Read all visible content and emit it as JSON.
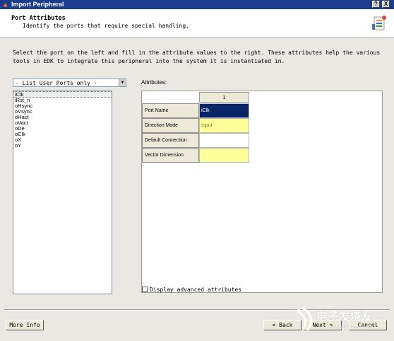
{
  "window": {
    "title": "Import Peripheral",
    "help_button": "?",
    "close_button": "X"
  },
  "header": {
    "title": "Port Attributes",
    "subtitle": "Identify the ports that require special handling."
  },
  "description": "Select the port on the left and fill in the attribute values to the right. These attributes help the various tools in EDK to integrate this peripheral into the system it is instantiated in.",
  "port_filter": {
    "selected": "- List User Ports only -"
  },
  "ports": [
    "iClk",
    "iRst_n",
    "oHsync",
    "oVsync",
    "oHact",
    "oVact",
    "oDe",
    "oClk",
    "oX",
    "oY"
  ],
  "attributes": {
    "label": "Attributes:",
    "column_header": "1",
    "rows": [
      {
        "name": "Port Name",
        "value": "iClk"
      },
      {
        "name": "Direction Mode",
        "value": "Input"
      },
      {
        "name": "Default Connection",
        "value": ""
      },
      {
        "name": "Vector Dimension",
        "value": ""
      }
    ]
  },
  "advanced": {
    "label": "Display advanced attributes",
    "checked": false
  },
  "footer": {
    "more_info": "More Info",
    "back": "< Back",
    "next": "Next >",
    "cancel": "Cancel"
  },
  "watermark": {
    "title": "电子发烧友",
    "url": "www.elecfans.com"
  }
}
